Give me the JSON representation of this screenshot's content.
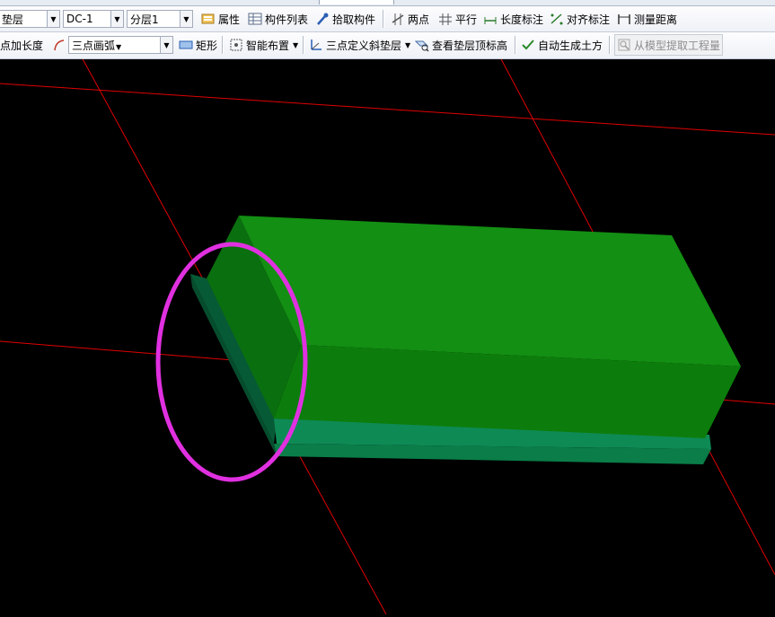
{
  "toolbar1": {
    "layer_combo": "垫层",
    "element_combo": "DC-1",
    "sublayer_combo": "分层1",
    "properties": "属性",
    "element_list": "构件列表",
    "pick_element": "拾取构件",
    "two_points": "两点",
    "parallel": "平行",
    "length_dim": "长度标注",
    "align_dim": "对齐标注",
    "measure_distance": "测量距离"
  },
  "toolbar2": {
    "point_length": "点加长度",
    "three_point_arc": "三点画弧",
    "rectangle": "矩形",
    "smart_layout": "智能布置",
    "three_point_slope": "三点定义斜垫层",
    "view_top_elev": "查看垫层顶标高",
    "auto_earthwork": "自动生成土方",
    "extract_quantity": "从模型提取工程量"
  },
  "colors": {
    "viewport_bg": "#000000",
    "axis_line": "#e00000",
    "top_face": "#128f12",
    "front_face": "#0b7d0b",
    "end_face": "#0a7010",
    "base_slab": "#0a7d48",
    "highlight_ellipse": "#e030e0"
  },
  "icons": [
    "properties-icon",
    "list-icon",
    "eyedropper-icon",
    "two-points-icon",
    "parallel-icon",
    "length-dim-icon",
    "align-dim-icon",
    "measure-icon",
    "arc-icon",
    "rectangle-icon",
    "smart-layout-icon",
    "slope-icon",
    "view-elevation-icon",
    "checkmark-icon",
    "extract-icon"
  ]
}
